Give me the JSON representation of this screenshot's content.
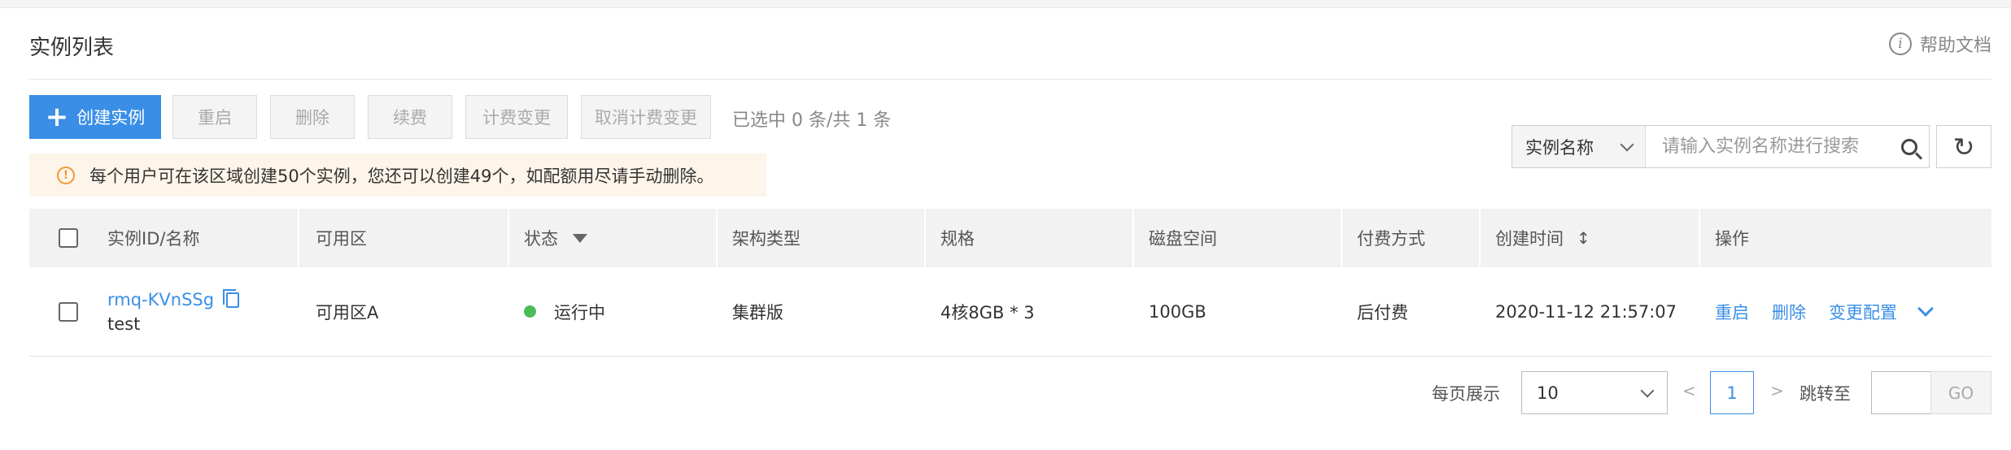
{
  "header": {
    "title": "实例列表",
    "help_label": "帮助文档"
  },
  "toolbar": {
    "create_label": "创建实例",
    "restart_label": "重启",
    "delete_label": "删除",
    "renew_label": "续费",
    "billing_change_label": "计费变更",
    "cancel_billing_change_label": "取消计费变更",
    "selection_info": "已选中 0 条/共 1 条"
  },
  "notice": {
    "text": "每个用户可在该区域创建50个实例，您还可以创建49个，如配额用尽请手动删除。"
  },
  "search": {
    "field_label": "实例名称",
    "placeholder": "请输入实例名称进行搜索"
  },
  "table": {
    "columns": {
      "id_name": "实例ID/名称",
      "zone": "可用区",
      "status": "状态",
      "arch": "架构类型",
      "spec": "规格",
      "disk": "磁盘空间",
      "payment": "付费方式",
      "created": "创建时间",
      "actions": "操作"
    },
    "rows": [
      {
        "id": "rmq-KVnSSg",
        "name": "test",
        "zone": "可用区A",
        "status": "运行中",
        "arch": "集群版",
        "spec": "4核8GB * 3",
        "disk": "100GB",
        "payment": "后付费",
        "created": "2020-11-12 21:57:07",
        "action_restart": "重启",
        "action_delete": "删除",
        "action_modify": "变更配置"
      }
    ]
  },
  "pagination": {
    "per_page_label": "每页展示",
    "per_page_value": "10",
    "prev": "<",
    "current_page": "1",
    "next": ">",
    "jump_label": "跳转至",
    "go_label": "GO"
  },
  "colors": {
    "primary": "#3a8ee6",
    "status_running": "#4cbb5a",
    "warning": "#f09a35"
  }
}
